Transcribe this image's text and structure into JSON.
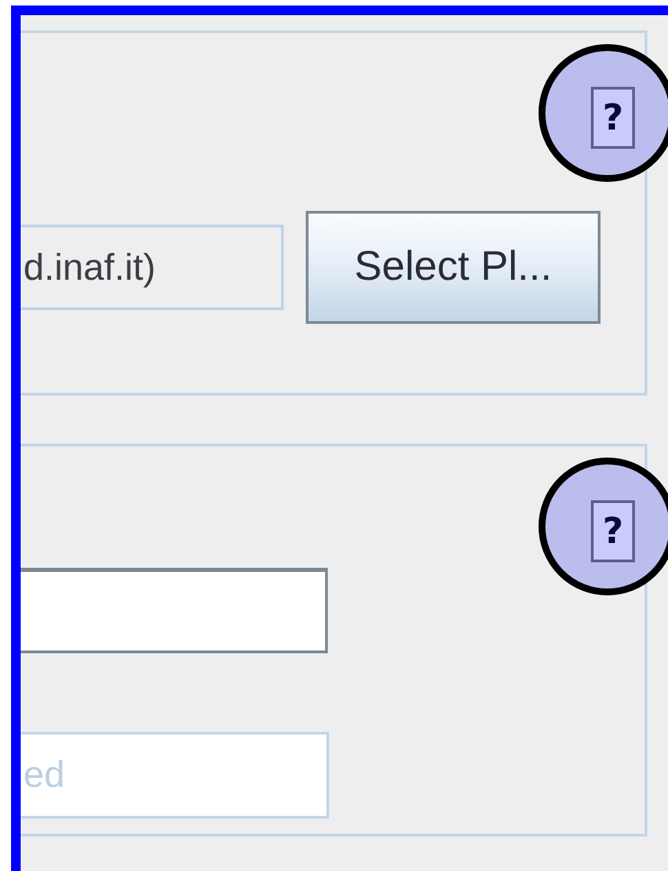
{
  "panels": [
    {
      "help": {
        "label": "?",
        "highlighted": true
      },
      "fields": [
        {
          "value": "d.inaf.it)",
          "editable": false,
          "disabled": false
        }
      ],
      "button": {
        "label": "Select Pl..."
      }
    },
    {
      "help": {
        "label": "?",
        "highlighted": true
      },
      "fields": [
        {
          "editable": true,
          "disabled": false
        },
        {
          "value": "ed",
          "editable": true,
          "disabled": true
        }
      ]
    }
  ]
}
